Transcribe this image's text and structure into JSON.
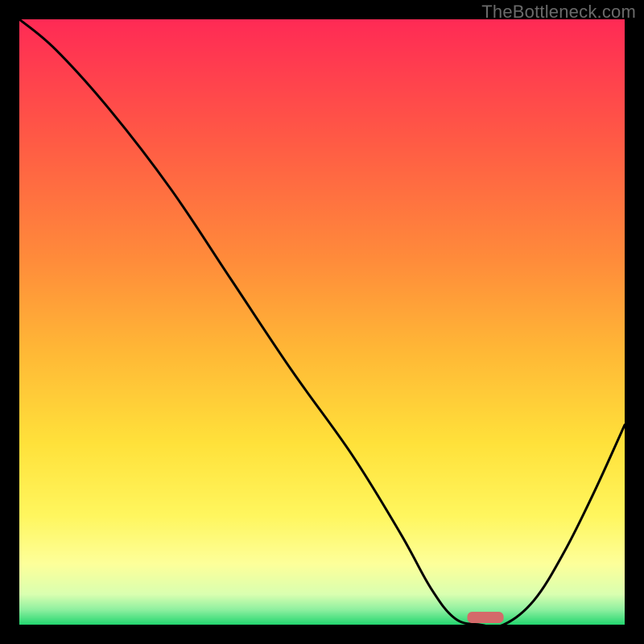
{
  "watermark": "TheBottleneck.com",
  "chart_data": {
    "type": "line",
    "title": "",
    "xlabel": "",
    "ylabel": "",
    "xlim": [
      0,
      100
    ],
    "ylim": [
      0,
      100
    ],
    "series": [
      {
        "name": "bottleneck-curve",
        "x": [
          0,
          6,
          15,
          25,
          35,
          45,
          55,
          63,
          68,
          72,
          76,
          80,
          85,
          90,
          95,
          100
        ],
        "values": [
          100,
          95,
          85,
          72,
          57,
          42,
          28,
          15,
          6,
          1,
          0,
          0,
          4,
          12,
          22,
          33
        ]
      }
    ],
    "marker": {
      "x": 77,
      "width": 6,
      "color": "#d46a6a"
    },
    "background_gradient": {
      "stops": [
        {
          "offset": 0.0,
          "color": "#ff2a55"
        },
        {
          "offset": 0.2,
          "color": "#ff5a45"
        },
        {
          "offset": 0.4,
          "color": "#ff8c3a"
        },
        {
          "offset": 0.55,
          "color": "#ffb836"
        },
        {
          "offset": 0.7,
          "color": "#ffe13a"
        },
        {
          "offset": 0.82,
          "color": "#fff65e"
        },
        {
          "offset": 0.9,
          "color": "#fdff9a"
        },
        {
          "offset": 0.95,
          "color": "#d9ffb0"
        },
        {
          "offset": 0.975,
          "color": "#8ff0a0"
        },
        {
          "offset": 1.0,
          "color": "#23d66f"
        }
      ]
    }
  }
}
